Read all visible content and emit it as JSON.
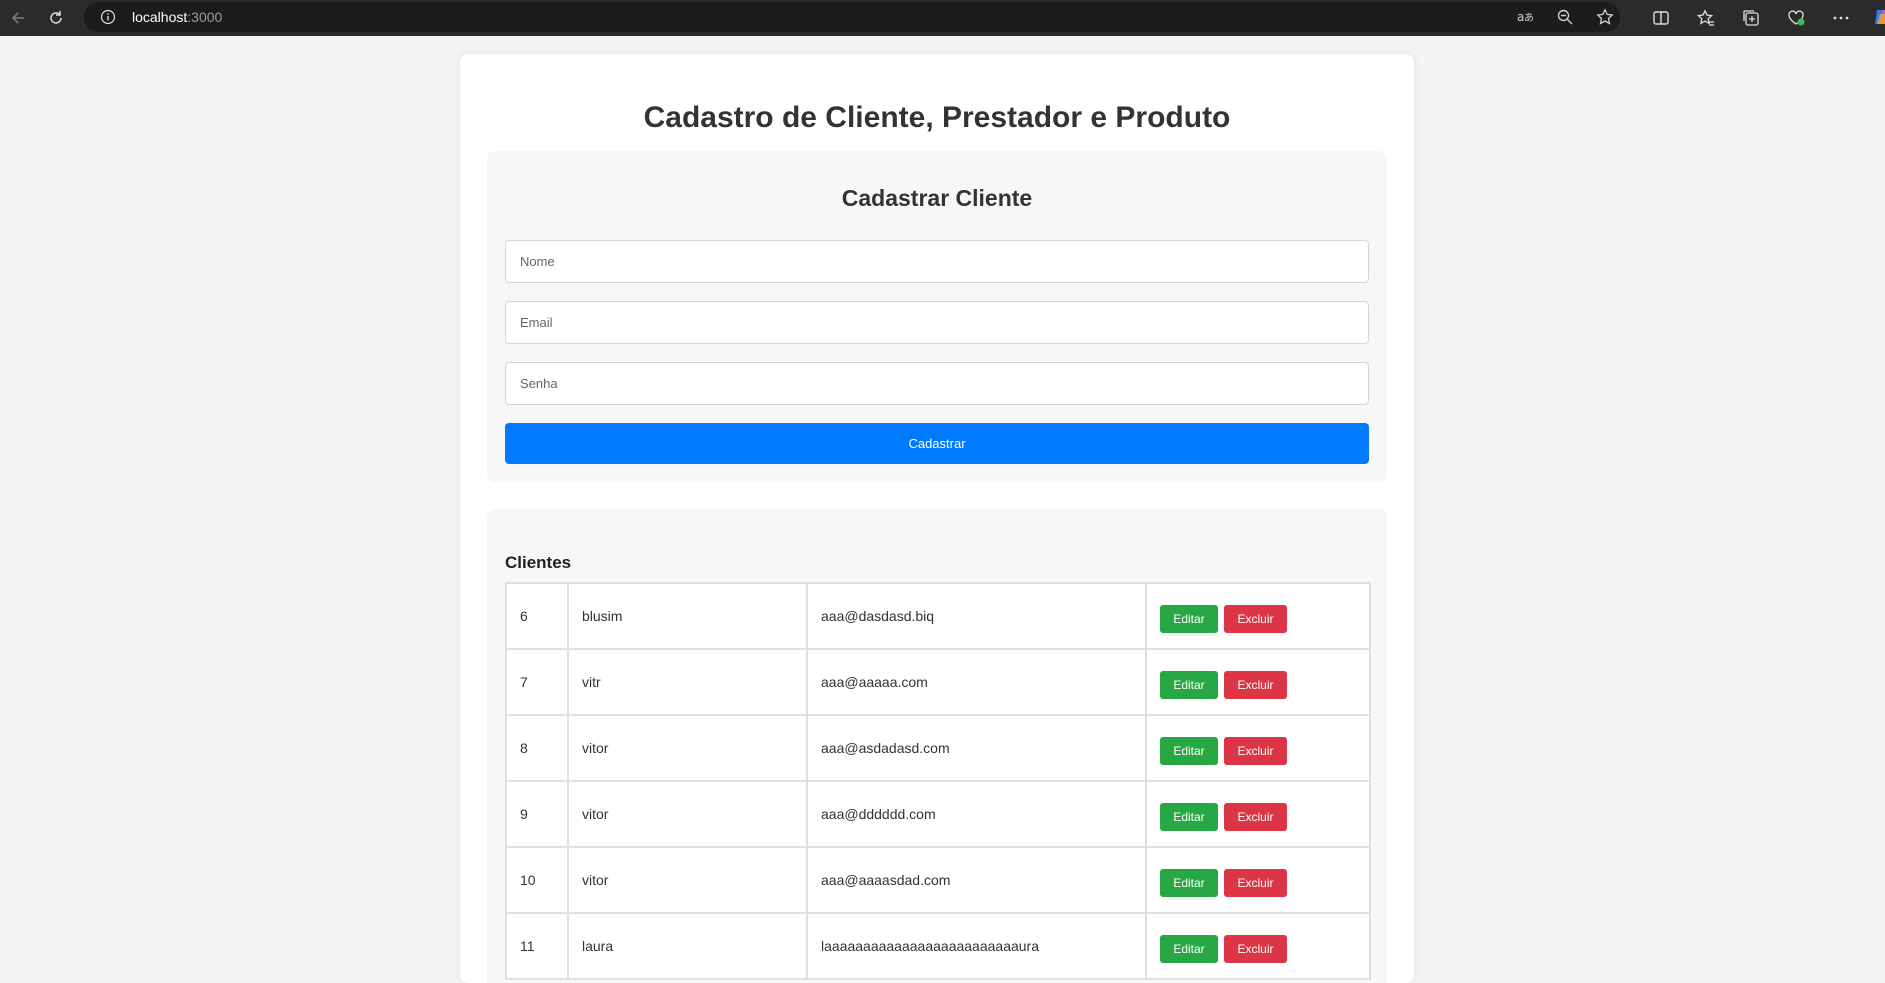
{
  "browser": {
    "url_host": "localhost",
    "url_port": ":3000",
    "icons": [
      "back-icon",
      "refresh-icon",
      "info-icon",
      "read-aloud-icon",
      "zoom-out-icon",
      "favorite-star-icon",
      "split-screen-icon",
      "favorites-icon",
      "collections-icon",
      "browser-essentials-icon",
      "more-icon",
      "copilot-icon"
    ]
  },
  "page": {
    "title": "Cadastro de Cliente, Prestador e Produto"
  },
  "form": {
    "title": "Cadastrar Cliente",
    "name_placeholder": "Nome",
    "email_placeholder": "Email",
    "password_placeholder": "Senha",
    "submit_label": "Cadastrar"
  },
  "clients": {
    "title": "Clientes",
    "edit_label": "Editar",
    "delete_label": "Excluir",
    "rows": [
      {
        "id": "6",
        "name": "blusim",
        "email": "aaa@dasdasd.biq",
        "edit": "Editar",
        "delete": "Excluir"
      },
      {
        "id": "7",
        "name": "vitr",
        "email": "aaa@aaaaa.com",
        "edit": "Editar",
        "delete": "Excluir"
      },
      {
        "id": "8",
        "name": "vitor",
        "email": "aaa@asdadasd.com",
        "edit": "Editar",
        "delete": "Excluir"
      },
      {
        "id": "9",
        "name": "vitor",
        "email": "aaa@dddddd.com",
        "edit": "Editar",
        "delete": "Excluir"
      },
      {
        "id": "10",
        "name": "vitor",
        "email": "aaa@aaaasdad.com",
        "edit": "Editar",
        "delete": "Excluir"
      },
      {
        "id": "11",
        "name": "laura",
        "email": "laaaaaaaaaaaaaaaaaaaaaaaaaura",
        "edit": "Editar",
        "delete": "Excluir"
      }
    ]
  },
  "colors": {
    "primary": "#007bff",
    "edit": "#28a745",
    "delete": "#dc3545",
    "chrome": "#2b2b2b"
  }
}
